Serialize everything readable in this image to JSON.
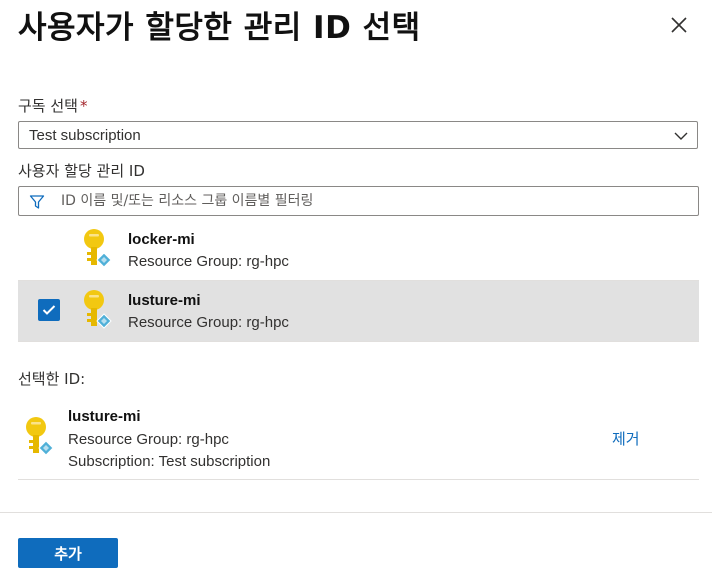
{
  "dialog": {
    "title": "사용자가 할당한 관리 ID 선택",
    "close_icon": "close-icon"
  },
  "subscription": {
    "label": "구독 선택",
    "required_mark": "*",
    "selected_value": "Test subscription"
  },
  "identity_section": {
    "label": "사용자 할당 관리 ID",
    "filter_placeholder": "ID 이름 및/또는 리소스 그룹 이름별 필터링"
  },
  "identities": [
    {
      "name": "locker-mi",
      "resource_group": "Resource Group: rg-hpc",
      "checked": false
    },
    {
      "name": "lusture-mi",
      "resource_group": "Resource Group: rg-hpc",
      "checked": true
    }
  ],
  "selected": {
    "label": "선택한 ID:",
    "items": [
      {
        "name": "lusture-mi",
        "resource_group": "Resource Group: rg-hpc",
        "subscription": "Subscription: Test subscription",
        "remove_label": "제거"
      }
    ]
  },
  "footer": {
    "add_label": "추가"
  },
  "colors": {
    "accent": "#0f6cbd",
    "selected_row": "#e1e1e1",
    "required": "#a4262c",
    "key_gold": "#f2c811",
    "key_badge": "#50b0d8"
  }
}
